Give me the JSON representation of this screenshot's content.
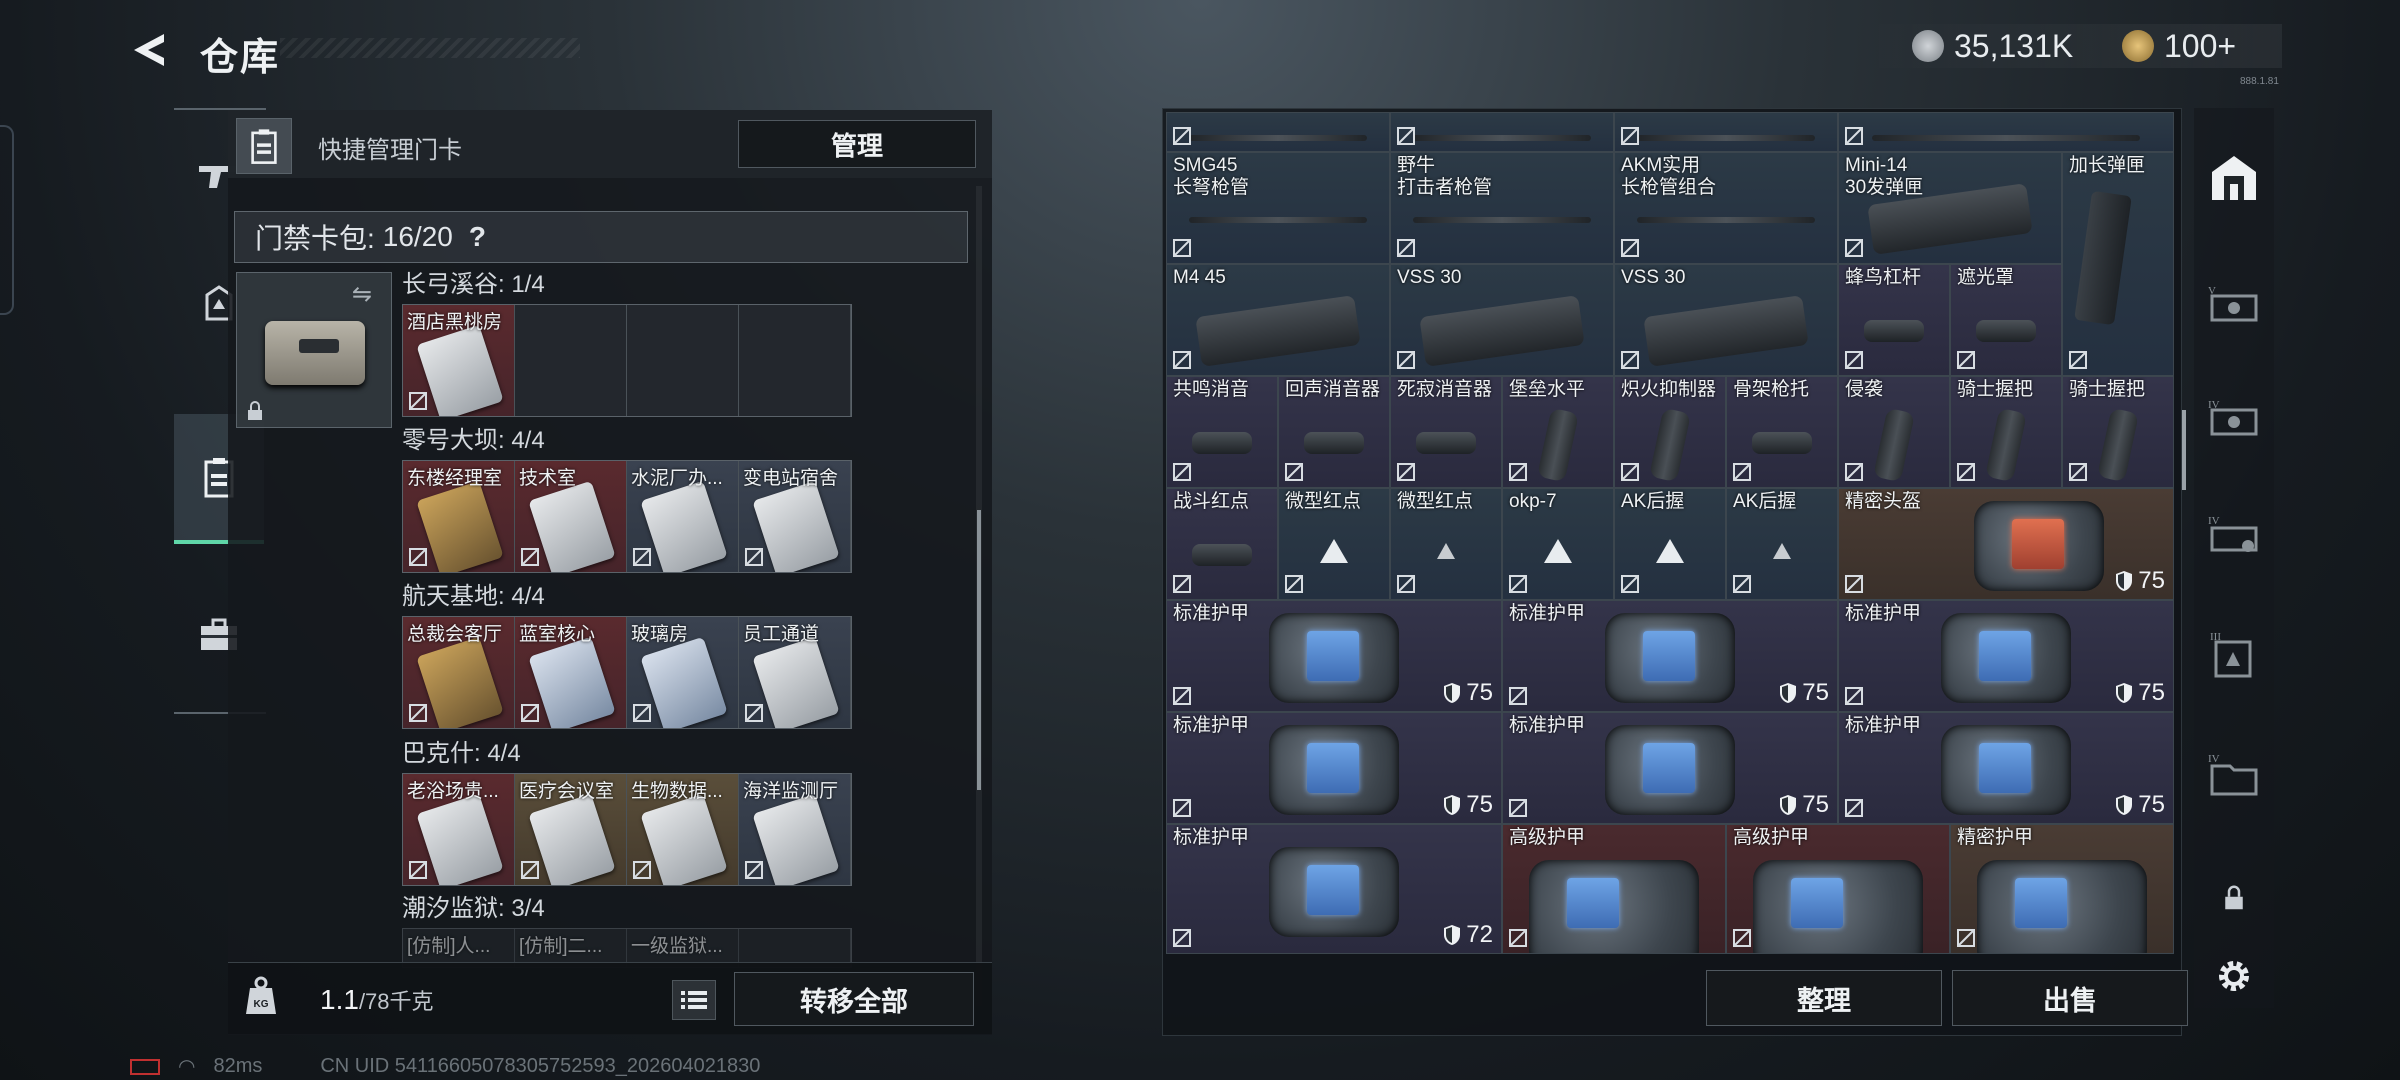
{
  "header": {
    "title": "仓库",
    "currency1": "35,131K",
    "currency2": "100+",
    "version": "888.1.81"
  },
  "left_nav": {
    "items": [
      {
        "icon": "rifle-icon",
        "active": false
      },
      {
        "icon": "helmet-icon",
        "active": false
      },
      {
        "icon": "keycard-bag-icon",
        "active": true
      },
      {
        "icon": "briefcase-icon",
        "active": false
      }
    ]
  },
  "quick": {
    "label": "快捷管理门卡",
    "manage_label": "管理"
  },
  "cardbag": {
    "label": "门禁卡包:",
    "count": "16/20",
    "help": "?"
  },
  "sections": [
    {
      "title": "长弓溪谷: 1/4",
      "slots": [
        {
          "label": "酒店黑桃房",
          "tone": "red",
          "card": "white"
        },
        {
          "label": "",
          "tone": "dark",
          "card": ""
        },
        {
          "label": "",
          "tone": "dark",
          "card": ""
        },
        {
          "label": "",
          "tone": "dark",
          "card": ""
        }
      ]
    },
    {
      "title": "零号大坝: 4/4",
      "slots": [
        {
          "label": "东楼经理室",
          "tone": "red",
          "card": "gold"
        },
        {
          "label": "技术室",
          "tone": "red",
          "card": "white"
        },
        {
          "label": "水泥厂办...",
          "tone": "blue",
          "card": "white"
        },
        {
          "label": "变电站宿舍",
          "tone": "blue",
          "card": "white"
        }
      ]
    },
    {
      "title": "航天基地: 4/4",
      "slots": [
        {
          "label": "总裁会客厅",
          "tone": "red",
          "card": "gold"
        },
        {
          "label": "蓝室核心",
          "tone": "red",
          "card": "blue"
        },
        {
          "label": "玻璃房",
          "tone": "blue",
          "card": "blue"
        },
        {
          "label": "员工通道",
          "tone": "blue",
          "card": "white"
        }
      ]
    },
    {
      "title": "巴克什: 4/4",
      "slots": [
        {
          "label": "老浴场贵...",
          "tone": "red",
          "card": "white"
        },
        {
          "label": "医疗会议室",
          "tone": "gold",
          "card": "white"
        },
        {
          "label": "生物数据...",
          "tone": "gold",
          "card": "white"
        },
        {
          "label": "海洋监测厅",
          "tone": "blue",
          "card": "white"
        }
      ]
    },
    {
      "title": "潮汐监狱: 3/4",
      "slots": [
        {
          "label": "[仿制]人...",
          "tone": "dark",
          "card": ""
        },
        {
          "label": "[仿制]二...",
          "tone": "dark",
          "card": ""
        },
        {
          "label": "一级监狱...",
          "tone": "dark",
          "card": ""
        },
        {
          "label": "",
          "tone": "dark",
          "card": ""
        }
      ]
    }
  ],
  "weight": {
    "value": "1.1",
    "max": "/78千克"
  },
  "transfer_label": "转移全部",
  "grid": [
    {
      "name": "",
      "tone": "blue",
      "art": "rod"
    },
    {
      "name": "",
      "tone": "blue",
      "art": "rod"
    },
    {
      "name": "",
      "tone": "blue",
      "art": "rod"
    },
    {
      "name": "",
      "tone": "blue",
      "art": "rod"
    },
    {
      "name": "SMG45\n长弩枪管",
      "tone": "blue",
      "art": "rod"
    },
    {
      "name": "野牛\n打击者枪管",
      "tone": "blue",
      "art": "rod"
    },
    {
      "name": "AKM实用\n长枪管组合",
      "tone": "blue",
      "art": "rod"
    },
    {
      "name": "Mini-14\n30发弹匣",
      "tone": "blue",
      "art": "mag"
    },
    {
      "name": "加长弹匣",
      "tone": "blue",
      "art": "longmag"
    },
    {
      "name": "M4 45",
      "tone": "blue",
      "art": "mag"
    },
    {
      "name": "VSS 30",
      "tone": "blue",
      "art": "mag"
    },
    {
      "name": "VSS 30",
      "tone": "blue",
      "art": "mag"
    },
    {
      "name": "蜂鸟杠杆",
      "tone": "purple",
      "art": "smallpart"
    },
    {
      "name": "遮光罩",
      "tone": "purple",
      "art": "smallpart"
    },
    {
      "name": "共鸣消音",
      "tone": "purple",
      "art": "smallpart"
    },
    {
      "name": "回声消音器",
      "tone": "purple",
      "art": "smallpart"
    },
    {
      "name": "死寂消音器",
      "tone": "purple",
      "art": "smallpart"
    },
    {
      "name": "堡垒水平",
      "tone": "purple",
      "art": "grip"
    },
    {
      "name": "炽火抑制器",
      "tone": "purple",
      "art": "grip"
    },
    {
      "name": "骨架枪托",
      "tone": "purple",
      "art": "smallpart"
    },
    {
      "name": "侵袭",
      "tone": "purple",
      "art": "grip"
    },
    {
      "name": "骑士握把",
      "tone": "purple",
      "art": "grip"
    },
    {
      "name": "骑士握把",
      "tone": "purple",
      "art": "grip"
    },
    {
      "name": "战斗红点",
      "tone": "purple",
      "art": "smallpart"
    },
    {
      "name": "微型红点",
      "tone": "blue",
      "art": "tri"
    },
    {
      "name": "微型红点",
      "tone": "blue",
      "art": "trism"
    },
    {
      "name": "okp-7",
      "tone": "blue",
      "art": "tri"
    },
    {
      "name": "AK后握",
      "tone": "blue",
      "art": "tri"
    },
    {
      "name": "AK后握",
      "tone": "blue",
      "art": "trism"
    },
    {
      "name": "精密头盔",
      "tone": "gold",
      "art": "vestred",
      "dur": "75"
    },
    {
      "name": "标准护甲",
      "tone": "purple",
      "art": "vest",
      "dur": "75"
    },
    {
      "name": "标准护甲",
      "tone": "purple",
      "art": "vest",
      "dur": "75"
    },
    {
      "name": "标准护甲",
      "tone": "purple",
      "art": "vest",
      "dur": "75"
    },
    {
      "name": "标准护甲",
      "tone": "purple",
      "art": "vest",
      "dur": "75"
    },
    {
      "name": "标准护甲",
      "tone": "purple",
      "art": "vest",
      "dur": "75"
    },
    {
      "name": "标准护甲",
      "tone": "purple",
      "art": "vest",
      "dur": "75"
    },
    {
      "name": "标准护甲",
      "tone": "purple",
      "art": "vest",
      "dur": "72"
    },
    {
      "name": "高级护甲",
      "tone": "red",
      "art": "vestbig"
    },
    {
      "name": "高级护甲",
      "tone": "red",
      "art": "vestbig"
    },
    {
      "name": "精密护甲",
      "tone": "gold",
      "art": "vestbig"
    }
  ],
  "sort_label": "整理",
  "sell_label": "出售",
  "right_nav": {
    "items": [
      "base-icon",
      "equipment-icon",
      "ammo-icon",
      "chest-icon",
      "card-icon",
      "folder-icon",
      "lock-icon",
      "settings-icon"
    ]
  },
  "status": {
    "ping": "82ms",
    "uid": "CN UID 5411660507830575259​3_202604021830"
  }
}
